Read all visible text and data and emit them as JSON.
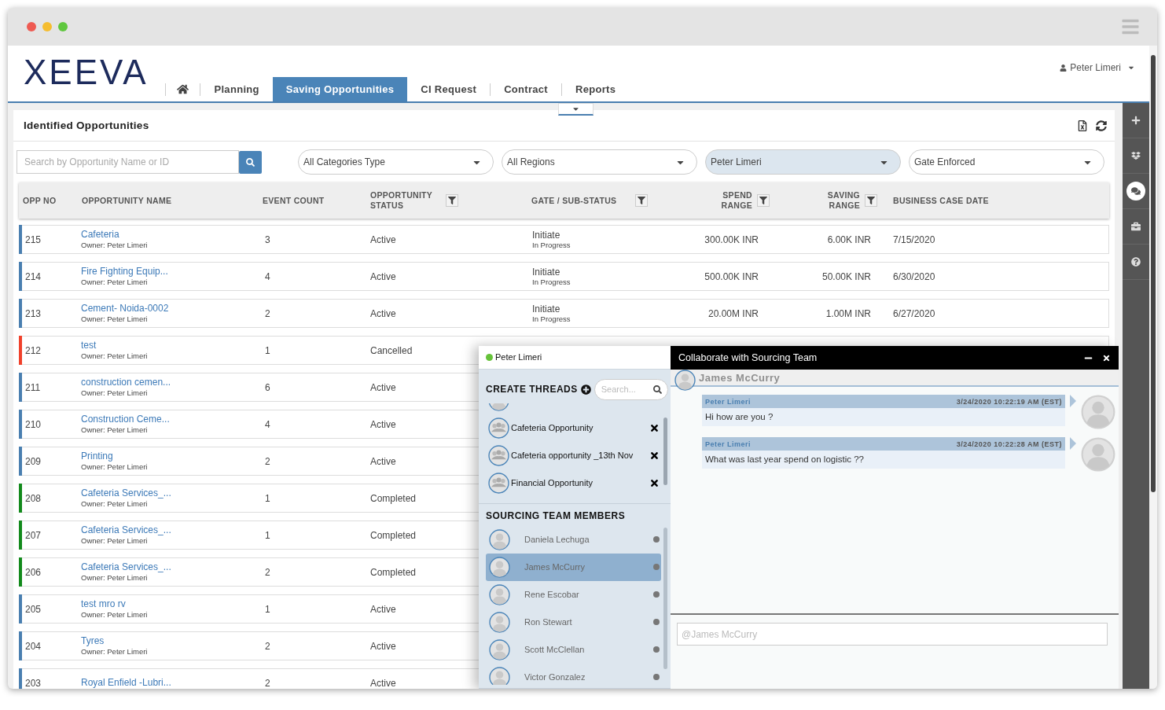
{
  "app": {
    "logo": "XEEVA",
    "user": "Peter Limeri"
  },
  "tabs": [
    {
      "label": "Planning",
      "selected": false
    },
    {
      "label": "Saving Opportunities",
      "selected": true
    },
    {
      "label": "CI Request",
      "selected": false
    },
    {
      "label": "Contract",
      "selected": false
    },
    {
      "label": "Reports",
      "selected": false
    }
  ],
  "panel": {
    "title": "Identified Opportunities",
    "search": {
      "placeholder": "Search by Opportunity Name or ID"
    },
    "filters": [
      {
        "value": "All Categories Type",
        "active": false
      },
      {
        "value": "All Regions",
        "active": false
      },
      {
        "value": "Peter Limeri",
        "active": true
      },
      {
        "value": "Gate Enforced",
        "active": false
      }
    ]
  },
  "table": {
    "columns": [
      {
        "label": "OPP NO",
        "filter": false
      },
      {
        "label": "OPPORTUNITY NAME",
        "filter": false
      },
      {
        "label": "EVENT COUNT",
        "filter": false
      },
      {
        "label": "OPPORTUNITY STATUS",
        "filter": true
      },
      {
        "label": "GATE / SUB-STATUS",
        "filter": true
      },
      {
        "label": "SPEND RANGE",
        "filter": true
      },
      {
        "label": "SAVING RANGE",
        "filter": true
      },
      {
        "label": "BUSINESS CASE DATE",
        "filter": false
      }
    ],
    "rows": [
      {
        "opp_no": "215",
        "name": "Cafeteria",
        "owner": "Owner: Peter Limeri",
        "event_count": "3",
        "status": "Active",
        "color": "#4a7fb0",
        "gate": "Initiate",
        "sub_status": "In Progress",
        "spend": "300.00K INR",
        "saving": "6.00K INR",
        "date": "7/15/2020"
      },
      {
        "opp_no": "214",
        "name": "Fire Fighting Equip...",
        "owner": "Owner: Peter Limeri",
        "event_count": "4",
        "status": "Active",
        "color": "#4a7fb0",
        "gate": "Initiate",
        "sub_status": "In Progress",
        "spend": "500.00K INR",
        "saving": "50.00K INR",
        "date": "6/30/2020"
      },
      {
        "opp_no": "213",
        "name": "Cement- Noida-0002",
        "owner": "Owner: Peter Limeri",
        "event_count": "2",
        "status": "Active",
        "color": "#4a7fb0",
        "gate": "Initiate",
        "sub_status": "In Progress",
        "spend": "20.00M INR",
        "saving": "1.00M INR",
        "date": "6/27/2020"
      },
      {
        "opp_no": "212",
        "name": "test",
        "owner": "Owner: Peter Limeri",
        "event_count": "1",
        "status": "Cancelled",
        "color": "#f0412b"
      },
      {
        "opp_no": "211",
        "name": "construction cemen...",
        "owner": "Owner: Peter Limeri",
        "event_count": "6",
        "status": "Active",
        "color": "#4a7fb0"
      },
      {
        "opp_no": "210",
        "name": "Construction Ceme...",
        "owner": "Owner: Peter Limeri",
        "event_count": "4",
        "status": "Active",
        "color": "#4a7fb0"
      },
      {
        "opp_no": "209",
        "name": "Printing",
        "owner": "Owner: Peter Limeri",
        "event_count": "2",
        "status": "Active",
        "color": "#4a7fb0"
      },
      {
        "opp_no": "208",
        "name": "Cafeteria Services_...",
        "owner": "Owner: Peter Limeri",
        "event_count": "1",
        "status": "Completed",
        "color": "#138a1c"
      },
      {
        "opp_no": "207",
        "name": "Cafeteria Services_...",
        "owner": "Owner: Peter Limeri",
        "event_count": "1",
        "status": "Completed",
        "color": "#138a1c"
      },
      {
        "opp_no": "206",
        "name": "Cafeteria Services_...",
        "owner": "Owner: Peter Limeri",
        "event_count": "2",
        "status": "Completed",
        "color": "#138a1c"
      },
      {
        "opp_no": "205",
        "name": "test mro rv",
        "owner": "Owner: Peter Limeri",
        "event_count": "1",
        "status": "Active",
        "color": "#4a7fb0"
      },
      {
        "opp_no": "204",
        "name": "Tyres",
        "owner": "Owner: Peter Limeri",
        "event_count": "2",
        "status": "Active",
        "color": "#4a7fb0"
      },
      {
        "opp_no": "203",
        "name": "Royal Enfield -Lubri...",
        "event_count": "2",
        "status": "Active",
        "color": "#4a7fb0"
      }
    ]
  },
  "sidebar": {
    "items": [
      {
        "selected": false
      },
      {
        "selected": false
      },
      {
        "selected": true
      },
      {
        "selected": false
      },
      {
        "selected": false
      }
    ]
  },
  "threads_panel": {
    "user": "Peter Limeri",
    "online": true,
    "threads_heading": "CREATE THREADS",
    "search": {
      "placeholder": "Search..."
    },
    "threads": [
      "Cafeteria Opportunity",
      "Cafeteria opportunity _13th Nov",
      "Financial Opportunity"
    ],
    "members_heading": "SOURCING TEAM MEMBERS",
    "members": [
      {
        "name": "Daniela Lechuga",
        "selected": false,
        "online": false
      },
      {
        "name": "James McCurry",
        "selected": true,
        "online": false
      },
      {
        "name": "Rene Escobar",
        "selected": false,
        "online": false
      },
      {
        "name": "Ron Stewart",
        "selected": false,
        "online": false
      },
      {
        "name": "Scott McClellan",
        "selected": false,
        "online": false
      },
      {
        "name": "Victor Gonzalez",
        "selected": false,
        "online": false
      }
    ]
  },
  "chat": {
    "title": "Collaborate with Sourcing Team",
    "recipient": "James McCurry",
    "messages": [
      {
        "sender": "Peter Limeri",
        "time": "3/24/2020 10:22:19 AM (EST)",
        "text": "Hi how are you ?"
      },
      {
        "sender": "Peter Limeri",
        "time": "3/24/2020 10:22:28 AM (EST)",
        "text": "What was last year spend on logistic ??"
      }
    ],
    "input": {
      "placeholder": "@James McCurry"
    }
  }
}
